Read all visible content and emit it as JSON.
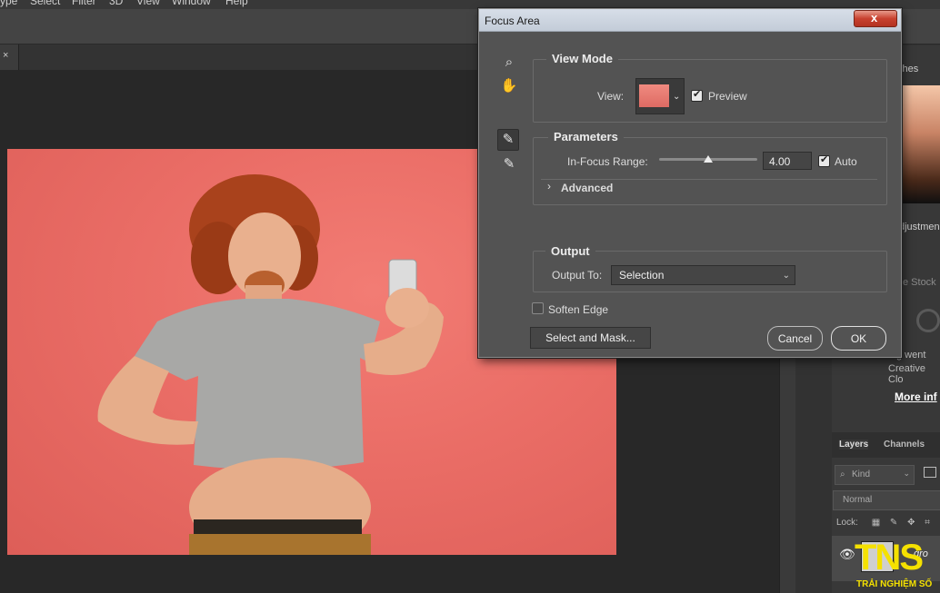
{
  "app": {
    "menu": [
      "ype",
      "Select",
      "Filter",
      "3D",
      "View",
      "Window",
      "Help"
    ],
    "doc_tab_close": "×",
    "panel_tab_partial": "ches",
    "adjustments_partial": "djustmen",
    "stock_partial": "e Stock",
    "panel_msg_line1": "g went",
    "panel_msg_line2": "Creative Clo",
    "more_info": "More inf",
    "layers_tab": "Layers",
    "channels_tab": "Channels",
    "kind_placeholder": "Kind",
    "blend_mode": "Normal",
    "lock_label": "Lock:",
    "layer_name_partial": "gro"
  },
  "dialog": {
    "title": "Focus Area",
    "close_glyph": "x",
    "view_mode": {
      "title": "View Mode",
      "view_label": "View:",
      "preview_label": "Preview",
      "preview_checked": true
    },
    "parameters": {
      "title": "Parameters",
      "in_focus_label": "In-Focus Range:",
      "in_focus_value": "4.00",
      "slider_fraction": 0.5,
      "auto_label": "Auto",
      "auto_checked": true,
      "advanced_label": "Advanced"
    },
    "output": {
      "title": "Output",
      "output_to_label": "Output To:",
      "output_to_value": "Selection"
    },
    "soften_edge_label": "Soften Edge",
    "soften_edge_checked": false,
    "select_and_mask_label": "Select and Mask...",
    "cancel_label": "Cancel",
    "ok_label": "OK"
  },
  "watermark": {
    "brand": "TNS",
    "tagline": "TRẢI NGHIỆM SỐ"
  }
}
